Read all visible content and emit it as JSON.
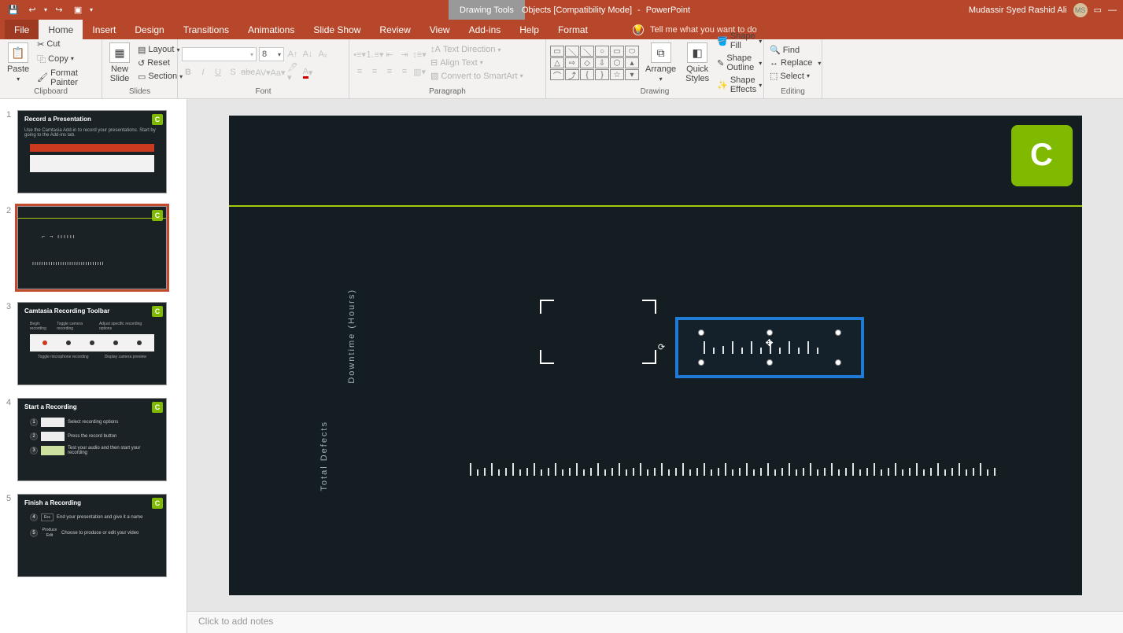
{
  "title": {
    "context_tool": "Drawing Tools",
    "document": "Objects [Compatibility Mode]",
    "app": "PowerPoint",
    "user": "Mudassir Syed Rashid Ali",
    "user_initials": "MS"
  },
  "tabs": {
    "file": "File",
    "home": "Home",
    "insert": "Insert",
    "design": "Design",
    "transitions": "Transitions",
    "animations": "Animations",
    "slideshow": "Slide Show",
    "review": "Review",
    "view": "View",
    "addins": "Add-ins",
    "help": "Help",
    "format": "Format",
    "tellme": "Tell me what you want to do"
  },
  "ribbon": {
    "clipboard": {
      "label": "Clipboard",
      "paste": "Paste",
      "cut": "Cut",
      "copy": "Copy",
      "fmt": "Format Painter"
    },
    "slides": {
      "label": "Slides",
      "new": "New\nSlide",
      "layout": "Layout",
      "reset": "Reset",
      "section": "Section"
    },
    "font": {
      "label": "Font",
      "size": "8"
    },
    "paragraph": {
      "label": "Paragraph",
      "textdir": "Text Direction",
      "align": "Align Text",
      "smartart": "Convert to SmartArt"
    },
    "drawing": {
      "label": "Drawing",
      "arrange": "Arrange",
      "quick": "Quick\nStyles",
      "fill": "Shape Fill",
      "outline": "Shape Outline",
      "effects": "Shape Effects"
    },
    "editing": {
      "label": "Editing",
      "find": "Find",
      "replace": "Replace",
      "select": "Select"
    }
  },
  "thumbs": [
    {
      "n": "1",
      "title": "Record a Presentation",
      "sub": "Use the Camtasia Add-in to record your presentations. Start by going to the Add-ins tab."
    },
    {
      "n": "2",
      "title": ""
    },
    {
      "n": "3",
      "title": "Camtasia Recording Toolbar",
      "labels": [
        "Begin recording",
        "Toggle camera recording",
        "Adjust specific recording options",
        "Toggle microphone recording",
        "Display camera preview"
      ]
    },
    {
      "n": "4",
      "title": "Start a Recording",
      "steps": [
        "Select recording options",
        "Press the record button",
        "Test your audio and then start your recording"
      ]
    },
    {
      "n": "5",
      "title": "Finish a Recording",
      "steps": [
        "End your presentation and give it a name",
        "Choose to produce or edit your video"
      ],
      "badges": [
        "Esc",
        "Produce",
        "Edit"
      ]
    }
  ],
  "slide": {
    "vlabel1": "Downtime (Hours)",
    "vlabel2": "Total Defects"
  },
  "notes": {
    "placeholder": "Click to add notes"
  }
}
